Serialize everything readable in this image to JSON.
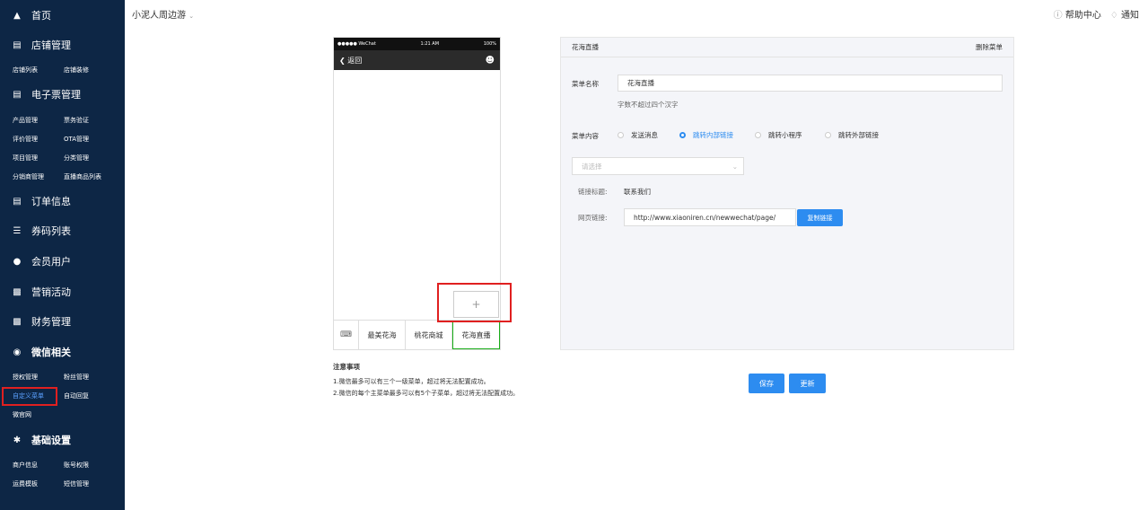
{
  "sidebar": {
    "home": "首页",
    "store_mgmt": "店铺管理",
    "store_list": "店铺列表",
    "store_decor": "店铺装修",
    "eticket_mgmt": "电子票管理",
    "product_mgmt": "产品管理",
    "ticket_verify": "票务验证",
    "review_mgmt": "评价管理",
    "ota_mgmt": "OTA管理",
    "project_mgmt": "项目管理",
    "category_mgmt": "分类管理",
    "distributor_mgmt": "分销商管理",
    "live_product_list": "直播商品列表",
    "order_info": "订单信息",
    "coupon_list": "券码列表",
    "member_users": "会员用户",
    "marketing": "营销活动",
    "finance": "财务管理",
    "wechat": "微信相关",
    "auth_mgmt": "授权管理",
    "fans_mgmt": "粉丝管理",
    "custom_menu": "自定义菜单",
    "auto_reply": "自动回复",
    "micro_site": "微官网",
    "basic_settings": "基础设置",
    "merchant_info": "商户信息",
    "account_perm": "账号权限",
    "freight_template": "运费模板",
    "sms_mgmt": "短信管理"
  },
  "topbar": {
    "title": "小泥人周边游",
    "help": "帮助中心",
    "notify": "通知"
  },
  "phone": {
    "carrier": "●●●●● WeChat",
    "time": "1:21 AM",
    "battery": "100%",
    "back": "返回",
    "add": "+",
    "menus": [
      "最美花海",
      "桃花商城",
      "花海直播"
    ]
  },
  "notes": {
    "title": "注意事项",
    "line1": "1.微信最多可以有三个一级菜单，超过将无法配置成功。",
    "line2": "2.微信的每个主菜单最多可以有5个子菜单，超过将无法配置成功。"
  },
  "panel": {
    "title": "花海直播",
    "delete": "删除菜单",
    "name_label": "菜单名称",
    "name_value": "花海直播",
    "name_hint": "字数不超过四个汉字",
    "content_label": "菜单内容",
    "options": [
      "发送消息",
      "跳转内部链接",
      "跳转小程序",
      "跳转外部链接"
    ],
    "selected_option": "跳转内部链接",
    "select_placeholder": "请选择",
    "link_title_label": "链接标题:",
    "link_title_value": "联系我们",
    "url_label": "网页链接:",
    "url_value": "http://www.xiaoniren.cn/newwechat/page/",
    "copy_button": "复制链接"
  },
  "actions": {
    "save": "保存",
    "update": "更新"
  },
  "colors": {
    "sidebar_bg": "#0d2645",
    "primary": "#2d8cf0",
    "highlight": "#e02020",
    "wechat_green": "#1aad19"
  }
}
